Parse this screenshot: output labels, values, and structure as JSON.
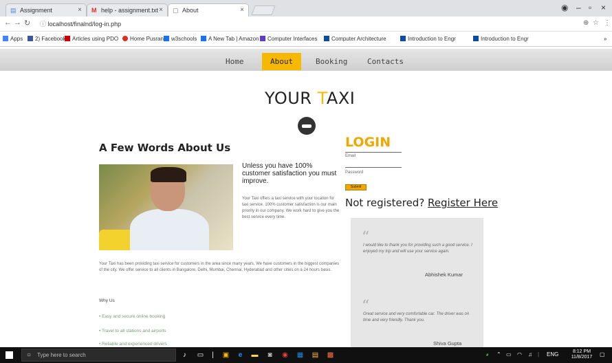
{
  "browser": {
    "tabs": [
      {
        "label": "Assignment",
        "icon": "docs-icon",
        "active": false
      },
      {
        "label": "help - assignment.txt",
        "icon": "gmail-icon",
        "active": false
      },
      {
        "label": "About",
        "icon": "page-icon",
        "active": true
      }
    ],
    "url": "localhost/finalnd/log-in.php",
    "bookmarks": [
      {
        "label": "Apps",
        "color": "#4285f4"
      },
      {
        "label": "2) Facebook",
        "color": "#3b5998"
      },
      {
        "label": "Articles using PDO",
        "color": "#cc0000"
      },
      {
        "label": "Home Pusran",
        "color": "#d93025"
      },
      {
        "label": "w3schools",
        "color": "#1a73e8"
      },
      {
        "label": "A New Tab | Amazon",
        "color": "#1a73e8"
      },
      {
        "label": "Computer Interfaces",
        "color": "#5f3dc4"
      },
      {
        "label": "Computer Architecture",
        "color": "#0a4da2"
      },
      {
        "label": "Introduction to Engr",
        "color": "#0a4da2"
      },
      {
        "label": "Introduction to Engr",
        "color": "#0a4da2"
      }
    ]
  },
  "site": {
    "nav": [
      "Home",
      "About",
      "Booking",
      "Contacts"
    ],
    "nav_active": "About",
    "logo_part1": "YOUR ",
    "logo_accent": "T",
    "logo_part2": "AXI",
    "about_heading": "A Few Words About Us",
    "quote_heading": "Unless you have 100% customer satisfaction you must improve.",
    "para_right": "Your Taxi offers a taxi service with your location for taxi service. 100% customer satisfaction is our main priority in our company. We work hard to give you the best service every time.",
    "para_full": "Your Taxi has been providing taxi service for customers in the area since many years. We have customers in the biggest companies of the city. We offer service to all clients in Bangalore, Delhi, Mumbai, Chennai, Hyderabad and other cities on a 24 hours basis.",
    "why_heading": "Why Us",
    "bullets": [
      "Easy and secure online booking",
      "Travel to all stations and airports",
      "Reliable and experienced drivers"
    ]
  },
  "login": {
    "heading": "LOGIN",
    "email_label": "Email",
    "password_label": "Password",
    "submit_label": "Submit",
    "notreg_text": "Not registered? ",
    "register_link": "Register Here"
  },
  "testimonials": [
    {
      "text": "I would like to thank you for providing such a good service. I enjoyed my trip and will use your service again.",
      "author": "Abhishek Kumar"
    },
    {
      "text": "Great service and very comfortable car. The driver was on time and very friendly. Thank you.",
      "author": "Shiva Gupta"
    }
  ],
  "taskbar": {
    "search_placeholder": "Type here to search",
    "tray_lang": "ENG",
    "time": "8:12 PM",
    "date": "11/8/2017"
  },
  "colors": {
    "accent": "#f7b800",
    "login_orange": "#f0a800"
  }
}
